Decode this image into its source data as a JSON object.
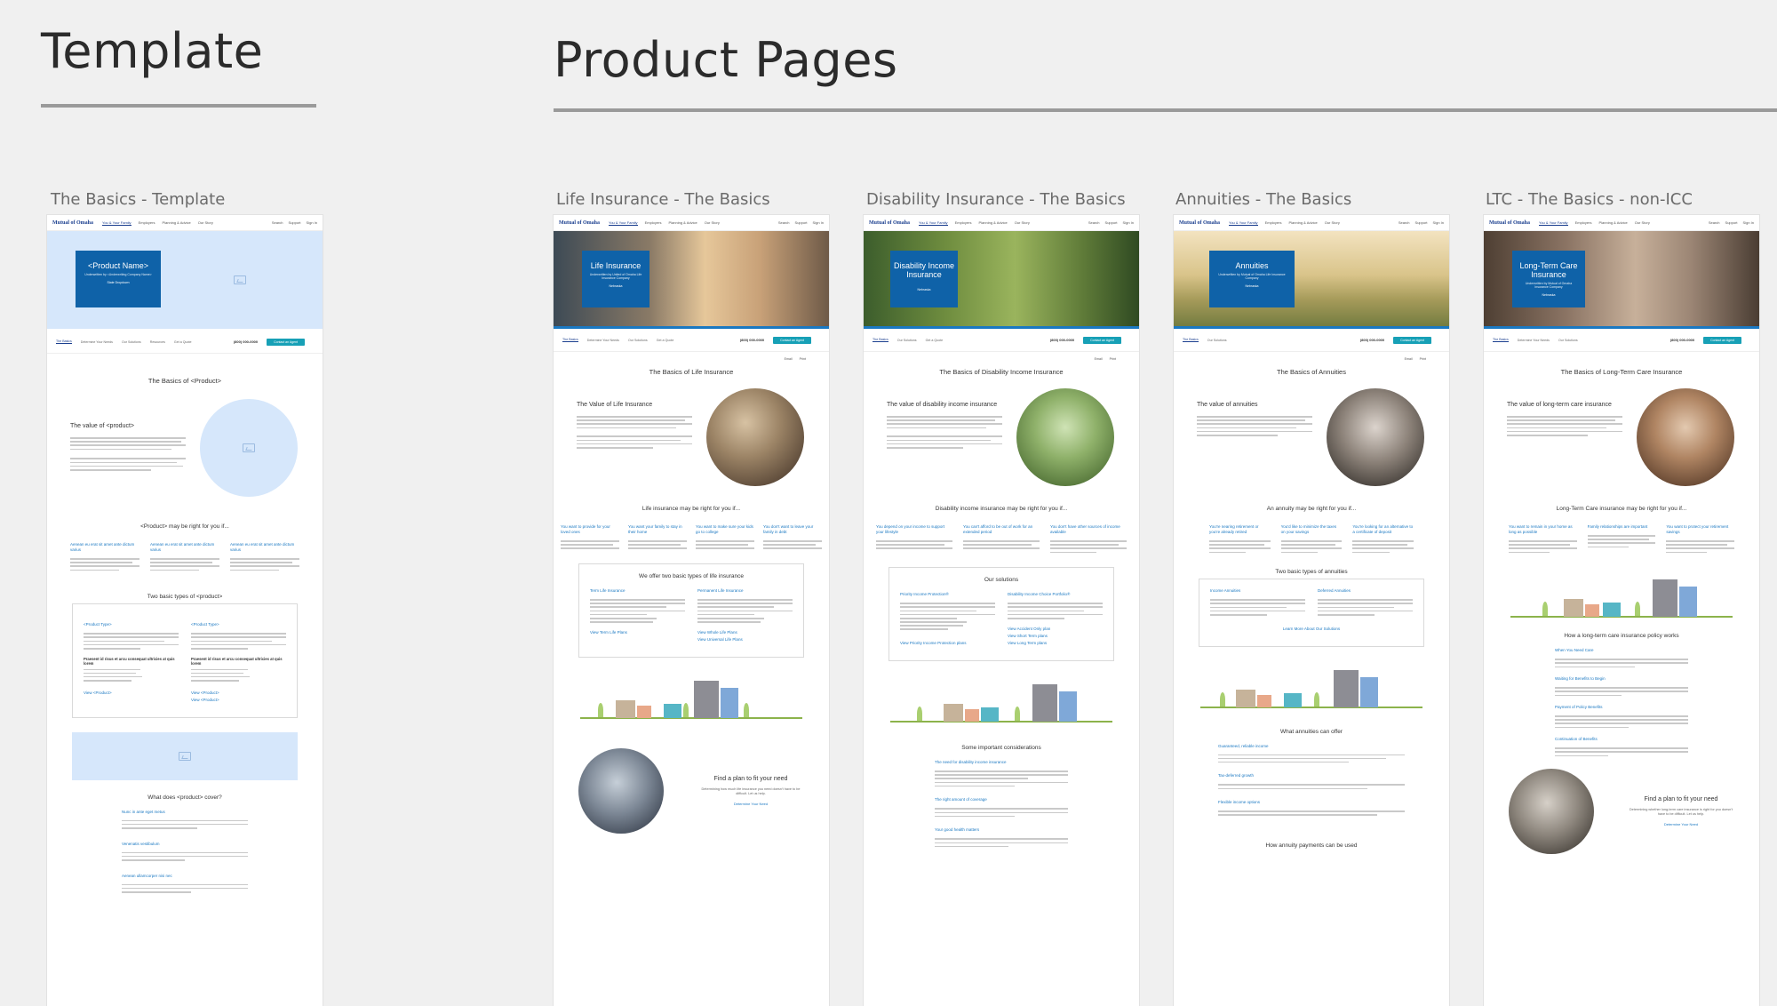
{
  "headings": {
    "template": "Template",
    "product_pages": "Product Pages"
  },
  "boards": [
    {
      "label": "The Basics - Template"
    },
    {
      "label": "Life Insurance - The Basics"
    },
    {
      "label": "Disability Insurance - The Basics"
    },
    {
      "label": "Annuities - The Basics"
    },
    {
      "label": "LTC - The Basics - non-ICC"
    }
  ],
  "nav": {
    "logo": "Mutual of Omaha",
    "links": [
      "You & Your Family",
      "Employers",
      "Planning & Advice",
      "Our Story"
    ],
    "right": [
      "Search",
      "Support",
      "Sign In"
    ]
  },
  "template_page": {
    "hero_title": "<Product Name>",
    "hero_sub": "Underwritten by <Underwriting Company Name>",
    "hero_link": "State Dropdown",
    "subnav": [
      "The Basics",
      "Determine Your Needs",
      "Our Solutions",
      "Resources",
      "Get a Quote"
    ],
    "phone": "(800) 000-0000",
    "cta": "Contact an Agent",
    "basics_title": "The Basics of <Product>",
    "value_title": "The value of <product>",
    "right_for_you": "<Product> may be right for you if...",
    "three_links": [
      "Aenean eu erat sit amet ante dictum varius",
      "Aenean eu erat sit amet ante dictum varius",
      "Aenean eu erat sit amet ante dictum varius"
    ],
    "two_types": "Two basic types of <product>",
    "type_names": [
      "<Product Type>",
      "<Product Type>"
    ],
    "type_subhead": "Praesent id risus et arcu consequat ultricies at quis lorem",
    "view_links": [
      "View <Product>",
      "View <Product>",
      "View <Product>"
    ],
    "covers_title": "What does <product> cover?",
    "cover_items": [
      "Nunc in ante eget metus",
      "Venenatis vestibulum",
      "Aenean ullamcorper nisi nec"
    ]
  },
  "life_page": {
    "hero_title": "Life Insurance",
    "hero_sub": "Underwritten by United of Omaha Life Insurance Company",
    "hero_link": "Nebraska",
    "subnav": [
      "The Basics",
      "Determine Your Needs",
      "Our Solutions",
      "Get a Quote"
    ],
    "phone": "(800) 000-0000",
    "cta": "Contact an Agent",
    "utils": [
      "Email",
      "Print"
    ],
    "basics_title": "The Basics of Life Insurance",
    "value_title": "The Value of Life Insurance",
    "right_for_you": "Life insurance may be right for you if...",
    "links": [
      "You want to provide for your loved ones",
      "You want your family to stay in their home",
      "You want to make sure your kids go to college",
      "You don't want to leave your family in debt"
    ],
    "types_title": "We offer two basic types of life insurance",
    "type_names": [
      "Term Life Insurance",
      "Permanent Life Insurance"
    ],
    "view_links": [
      "View Term Life Plans",
      "View Whole Life Plans",
      "View Universal Life Plans"
    ],
    "plan_title": "Find a plan to fit your need",
    "plan_sub": "Determining how much life insurance you need doesn't have to be difficult. Let us help.",
    "plan_link": "Determine Your Need"
  },
  "disability_page": {
    "hero_title": "Disability Income Insurance",
    "hero_link": "Nebraska",
    "subnav": [
      "The Basics",
      "Our Solutions",
      "Get a Quote"
    ],
    "phone": "(800) 000-0000",
    "cta": "Contact an Agent",
    "utils": [
      "Email",
      "Print"
    ],
    "basics_title": "The Basics of Disability Income Insurance",
    "value_title": "The value of disability income insurance",
    "right_for_you": "Disability income insurance may be right for you if...",
    "links": [
      "You depend on your income to support your lifestyle",
      "You can't afford to be out of work for an extended period",
      "You don't have other sources of income available"
    ],
    "solutions_title": "Our solutions",
    "solutions": [
      "Priority Income Protection®",
      "Disability Income Choice Portfolio®"
    ],
    "view_links": [
      "View Priority Income Protection plans",
      "View Accident Only plan",
      "View Short Term plans",
      "View Long Term plans"
    ],
    "considerations": "Some important considerations",
    "consider_items": [
      "The need for disability income insurance",
      "The right amount of coverage",
      "Your good health matters"
    ]
  },
  "annuities_page": {
    "hero_title": "Annuities",
    "hero_sub": "Underwritten by Mutual of Omaha Life Insurance Company",
    "hero_link": "Nebraska",
    "subnav": [
      "The Basics",
      "Our Solutions"
    ],
    "phone": "(800) 000-0000",
    "cta": "Contact an Agent",
    "utils": [
      "Email",
      "Print"
    ],
    "basics_title": "The Basics of Annuities",
    "value_title": "The value of annuities",
    "right_for_you": "An annuity may be right for you if...",
    "links": [
      "You're nearing retirement or you're already retired",
      "You'd like to minimize the taxes on your savings",
      "You're looking for an alternative to a certificate of deposit"
    ],
    "types_title": "Two basic types of annuities",
    "type_names": [
      "Income Annuities",
      "Deferred Annuities"
    ],
    "learn_link": "Learn More About Our Solutions",
    "offer_title": "What annuities can offer",
    "offer_items": [
      "Guaranteed, reliable income",
      "Tax-deferred growth",
      "Flexible income options"
    ],
    "payments_title": "How annuity payments can be used"
  },
  "ltc_page": {
    "hero_title": "Long-Term Care Insurance",
    "hero_sub": "Underwritten by Mutual of Omaha Insurance Company",
    "hero_link": "Nebraska",
    "subnav": [
      "The Basics",
      "Determine Your Needs",
      "Our Solutions"
    ],
    "phone": "(800) 000-0000",
    "cta": "Contact an Agent",
    "utils": [
      "Email",
      "Print"
    ],
    "basics_title": "The Basics of Long-Term Care Insurance",
    "value_title": "The value of long-term care insurance",
    "right_for_you": "Long-Term Care insurance may be right for you if...",
    "links": [
      "You want to remain in your home as long as possible",
      "Family relationships are important",
      "You want to protect your retirement savings"
    ],
    "works_title": "How a long-term care insurance policy works",
    "works_items": [
      "When You Need Care",
      "Waiting for Benefits to Begin",
      "Payment of Policy Benefits",
      "Continuation of Benefits"
    ],
    "plan_title": "Find a plan to fit your need",
    "plan_sub": "Determining whether long-term care insurance is right for you doesn't have to be difficult. Let us help.",
    "plan_link": "Determine Your Need"
  },
  "colors": {
    "hero_blue": "#0f62a8",
    "accent_teal": "#17a0b6",
    "link_blue": "#1a78c2",
    "placeholder_blue": "#d6e7fb"
  }
}
